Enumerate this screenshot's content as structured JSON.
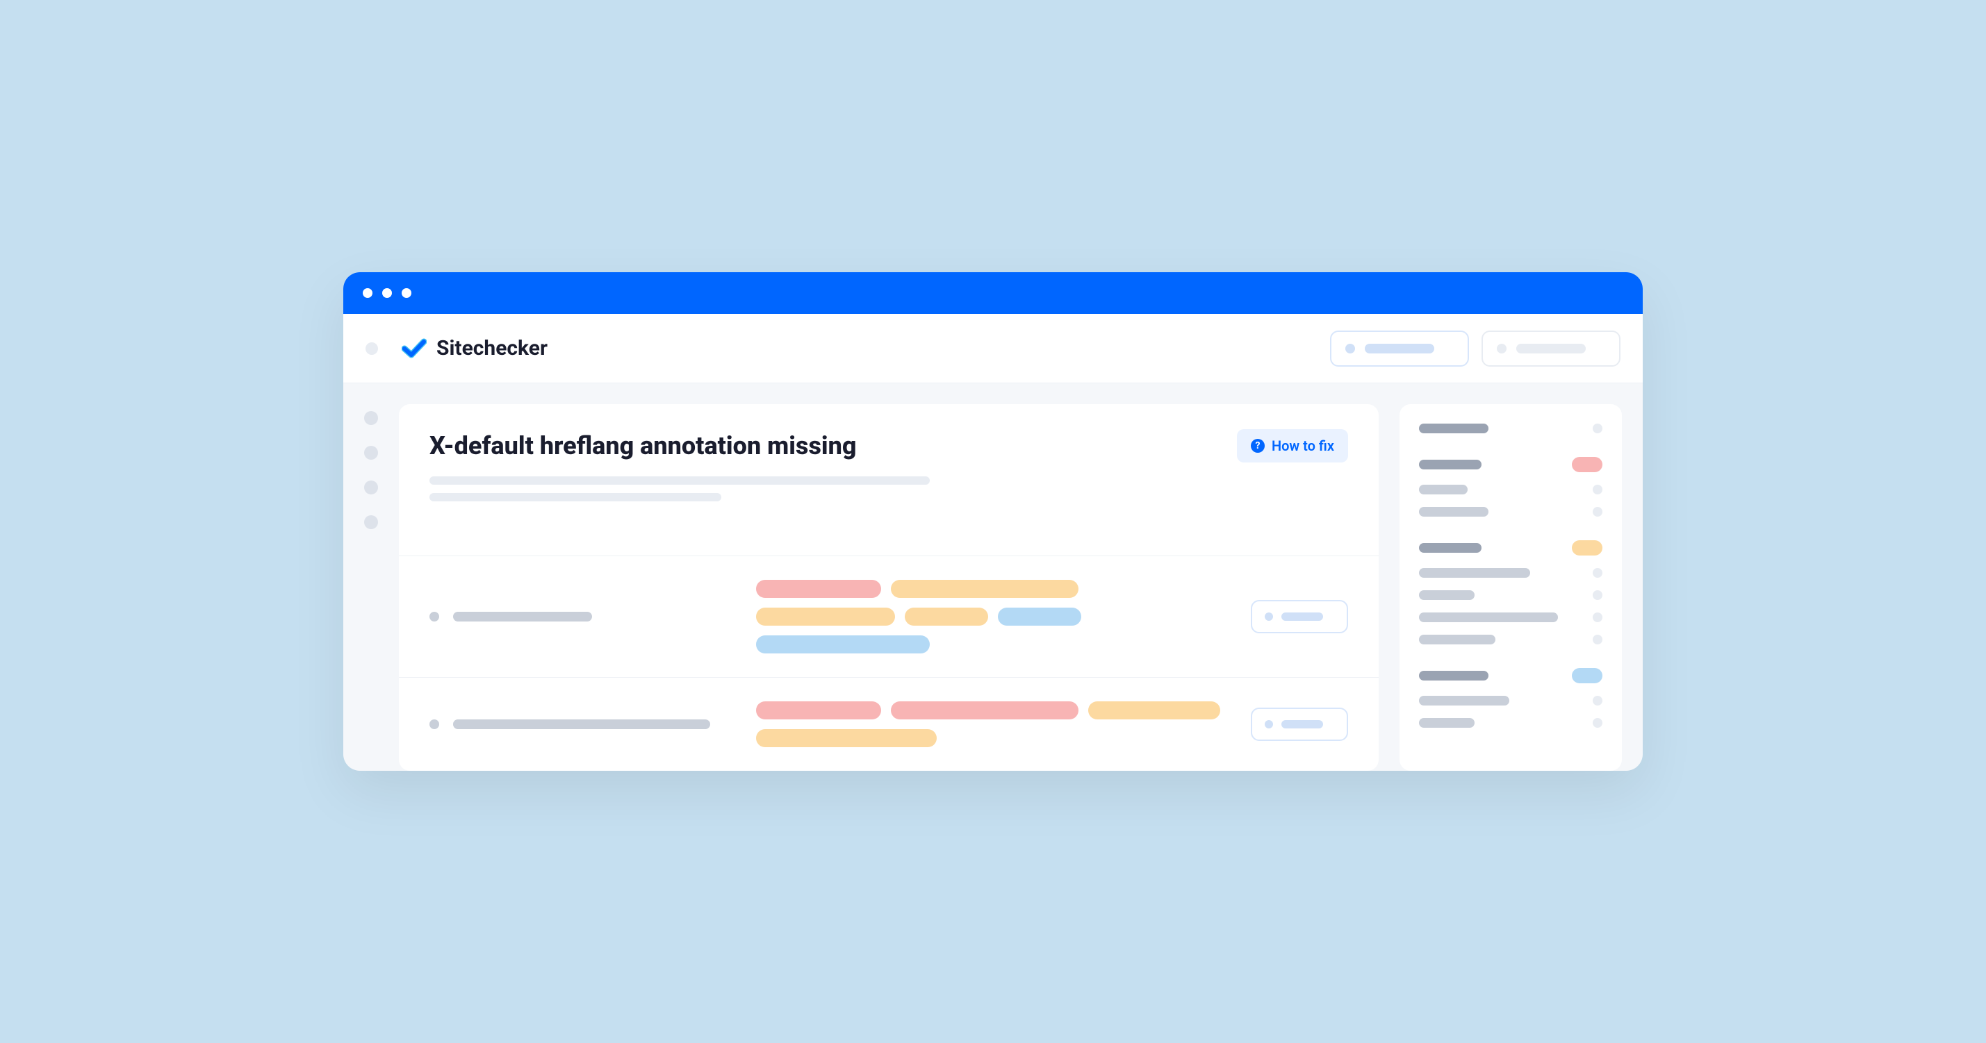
{
  "brand": {
    "name": "Sitechecker"
  },
  "page": {
    "title": "X-default hreflang annotation missing",
    "help_button": "How to fix"
  },
  "colors": {
    "primary": "#0066ff",
    "background": "#c5dff0",
    "panel": "#f5f7fa",
    "tag_red": "#f8b4b4",
    "tag_orange": "#fcd9a0",
    "tag_blue": "#b3d9f5"
  }
}
